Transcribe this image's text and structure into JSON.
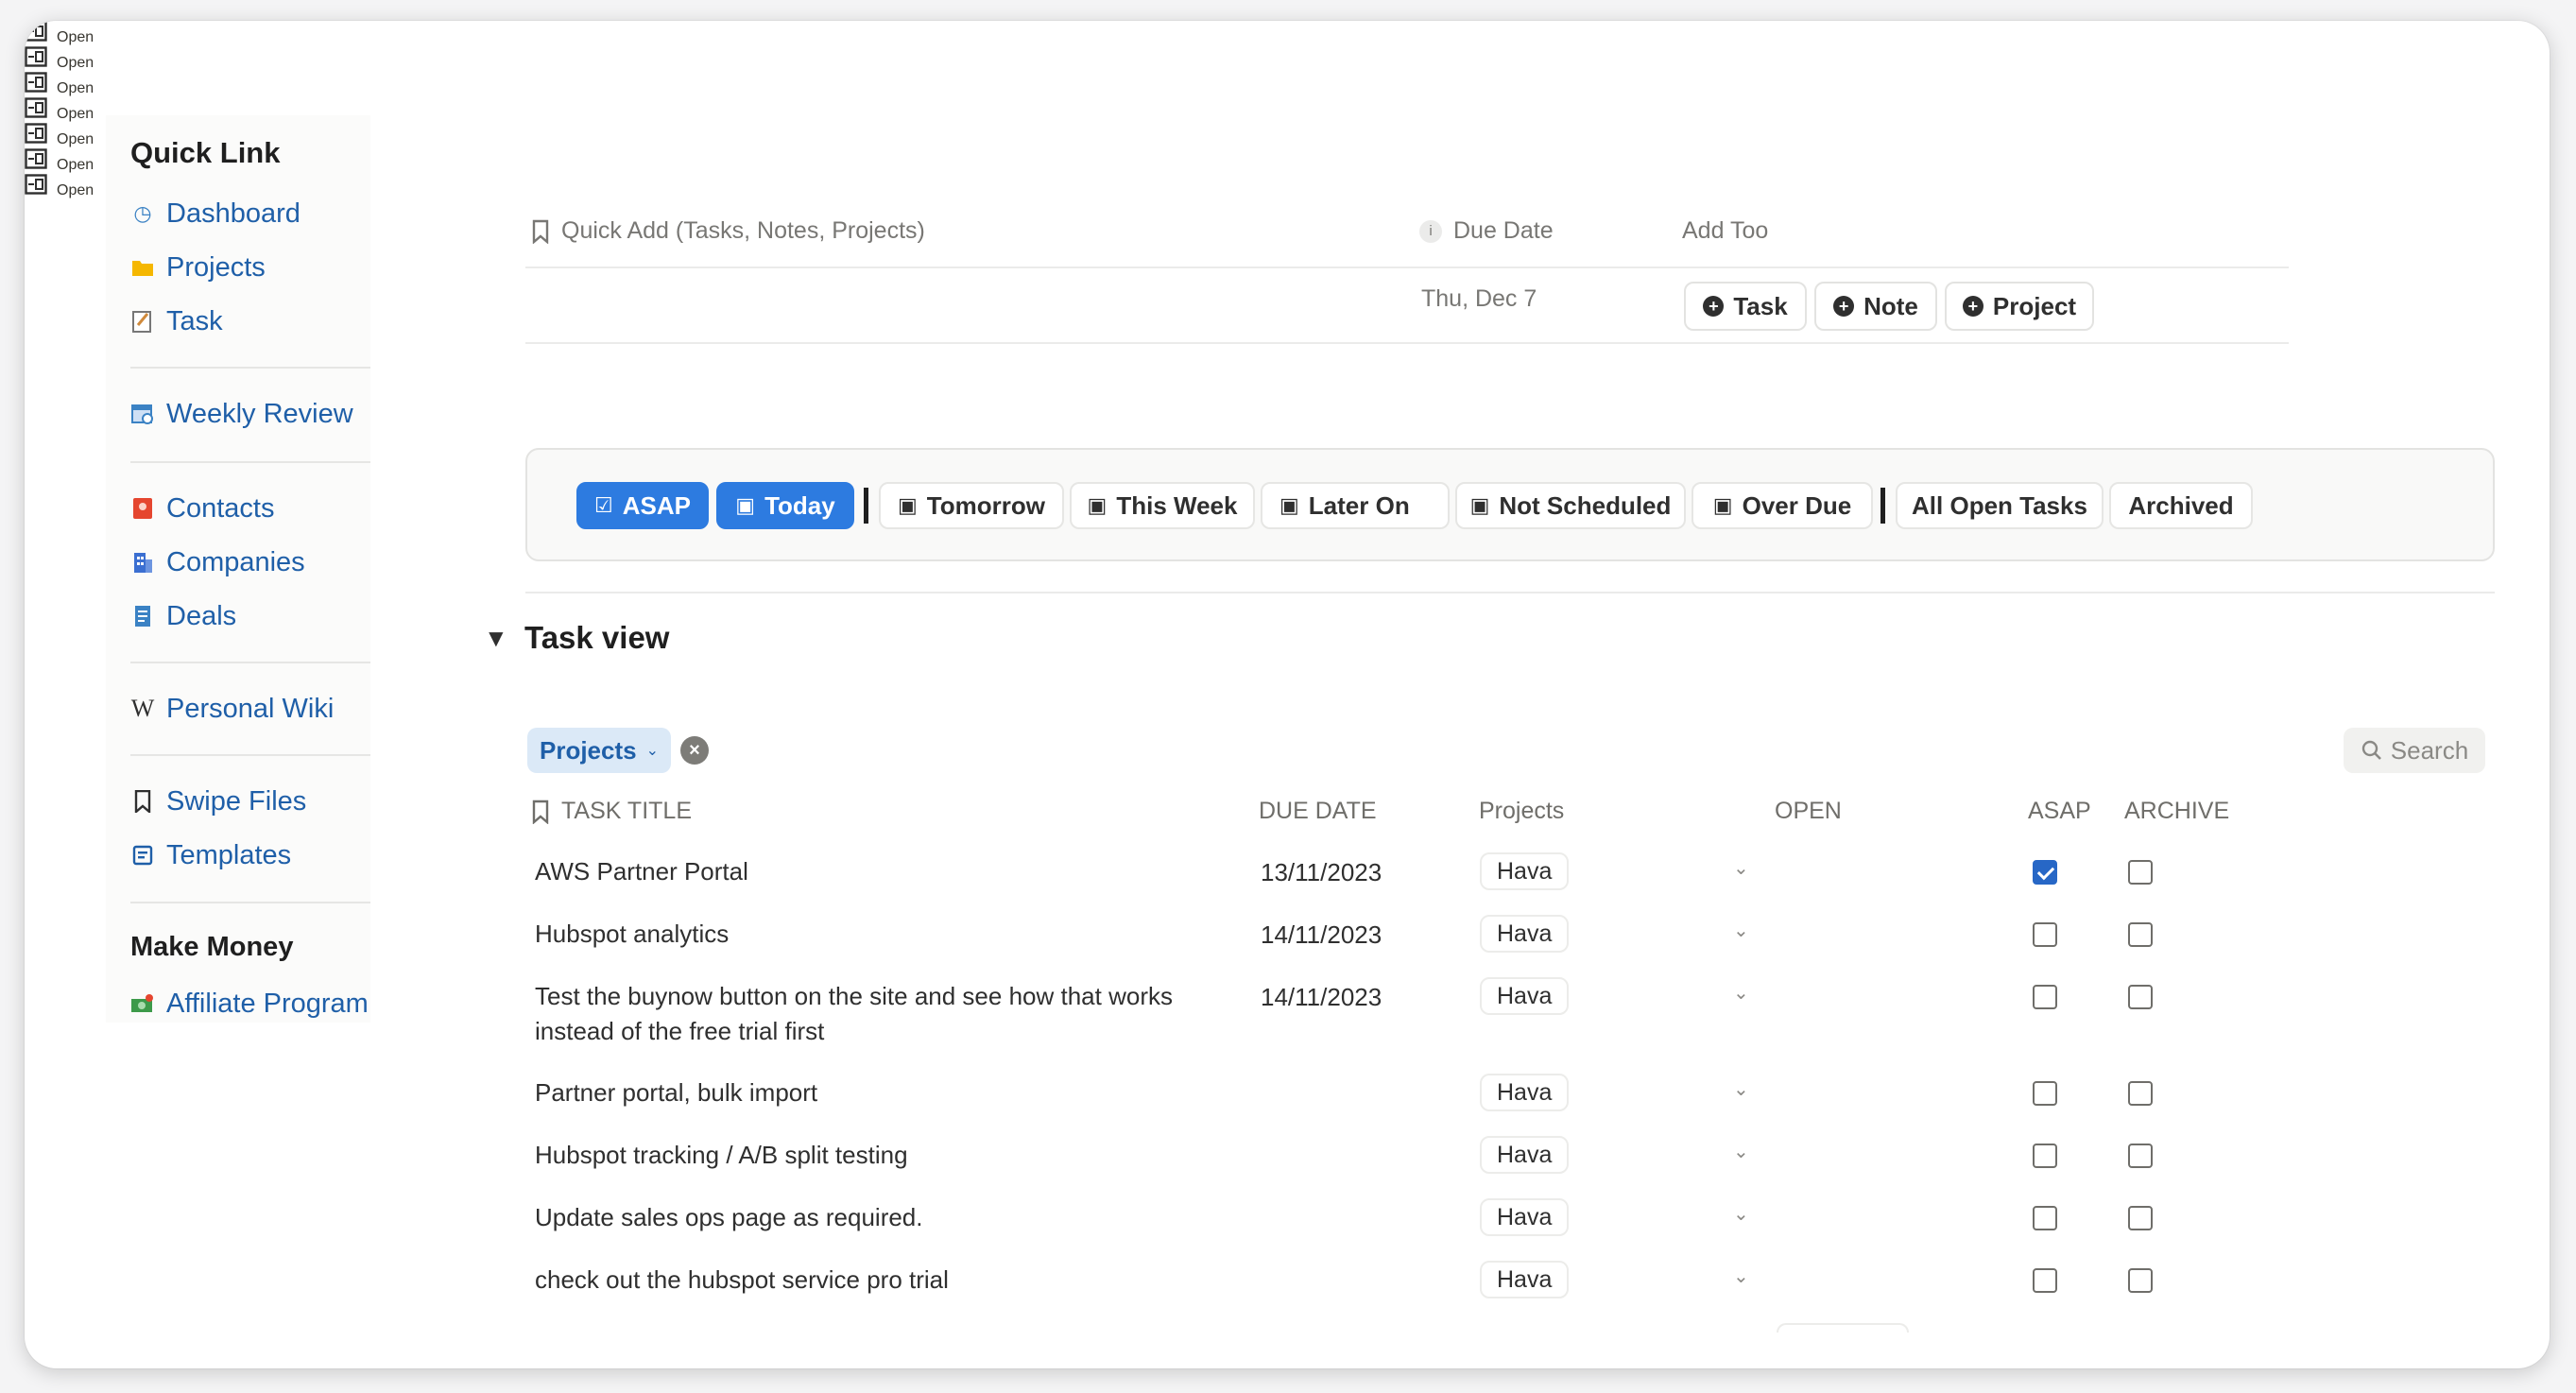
{
  "sidebar": {
    "quick_link_heading": "Quick Link",
    "items": [
      {
        "label": "Dashboard",
        "icon": "dashboard-icon",
        "glyph": "◷",
        "color": "#3b82c4"
      },
      {
        "label": "Projects",
        "icon": "folder-icon",
        "glyph": "▬",
        "color": "#f5b700"
      },
      {
        "label": "Task",
        "icon": "task-icon",
        "glyph": "✎",
        "color": "#a0522d"
      },
      {
        "label": "Weekly Review",
        "icon": "calendar-review-icon",
        "glyph": "▦",
        "color": "#3b82c4"
      },
      {
        "label": "Contacts",
        "icon": "contacts-book-icon",
        "glyph": "▮",
        "color": "#e5462f"
      },
      {
        "label": "Companies",
        "icon": "building-icon",
        "glyph": "▥",
        "color": "#3b6fd1"
      },
      {
        "label": "Deals",
        "icon": "document-icon",
        "glyph": "▤",
        "color": "#3b82c4"
      },
      {
        "label": "Personal Wiki",
        "icon": "wikipedia-icon",
        "glyph": "W",
        "color": "#2f2f2f"
      },
      {
        "label": "Swipe Files",
        "icon": "bookmark-icon",
        "glyph": "⌑",
        "color": "#2f2f2f"
      },
      {
        "label": "Templates",
        "icon": "template-icon",
        "glyph": "▣",
        "color": "#1f5fa8"
      },
      {
        "label": "Affiliate Program",
        "icon": "money-icon",
        "glyph": "▰",
        "color": "#3d9a4a"
      }
    ],
    "make_money_heading": "Make Money"
  },
  "quick_add": {
    "title_header": "Quick Add (Tasks, Notes, Projects)",
    "due_date_header": "Due Date",
    "add_too_header": "Add Too",
    "due_date_value": "Thu, Dec 7",
    "buttons": [
      "Task",
      "Note",
      "Project"
    ]
  },
  "filters": {
    "buttons": [
      "ASAP",
      "Today",
      "Tomorrow",
      "This Week",
      "Later On",
      "Not Scheduled",
      "Over Due",
      "All Open Tasks",
      "Archived"
    ],
    "active": [
      "ASAP",
      "Today"
    ]
  },
  "task_view": {
    "title": "Task view",
    "filter_chip": "Projects",
    "search_label": "Search",
    "columns": {
      "title": "TASK TITLE",
      "due": "DUE DATE",
      "projects": "Projects",
      "open": "OPEN",
      "asap": "ASAP",
      "archive": "ARCHIVE"
    },
    "open_label": "Open",
    "rows": [
      {
        "title": "AWS Partner Portal",
        "due": "13/11/2023",
        "project": "Hava",
        "asap": true,
        "archive": false
      },
      {
        "title": "Hubspot analytics",
        "due": "14/11/2023",
        "project": "Hava",
        "asap": false,
        "archive": false
      },
      {
        "title": "Test the buynow button on the site and see how that works instead of the free trial first",
        "due": "14/11/2023",
        "project": "Hava",
        "asap": false,
        "archive": false
      },
      {
        "title": "Partner portal, bulk import",
        "due": "",
        "project": "Hava",
        "asap": false,
        "archive": false
      },
      {
        "title": "Hubspot tracking / A/B split testing",
        "due": "",
        "project": "Hava",
        "asap": false,
        "archive": false
      },
      {
        "title": "Update sales ops page as required.",
        "due": "",
        "project": "Hava",
        "asap": false,
        "archive": false
      },
      {
        "title": "check out the hubspot service pro trial",
        "due": "",
        "project": "Hava",
        "asap": false,
        "archive": false
      }
    ]
  }
}
